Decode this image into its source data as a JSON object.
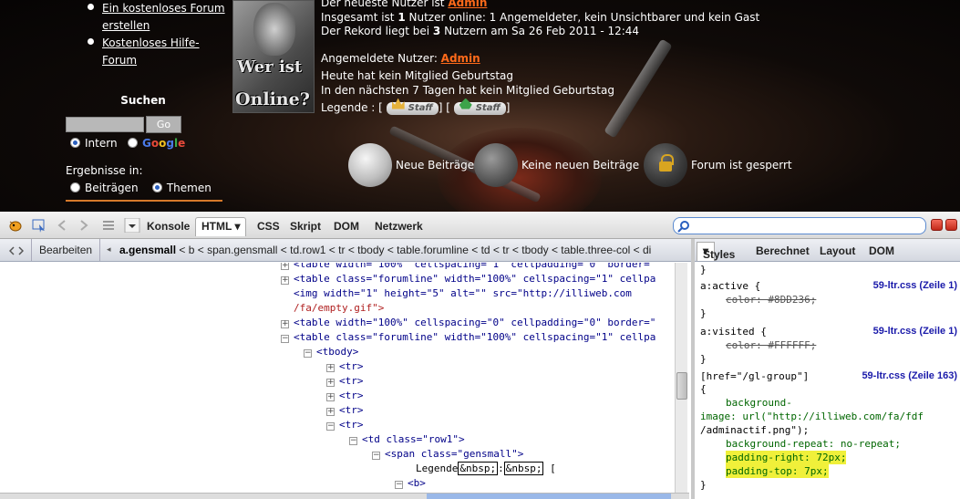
{
  "forum": {
    "sidebar_links": [
      "Ein kostenloses Forum erstellen",
      "Kostenloses Hilfe-Forum"
    ],
    "search": {
      "title": "Suchen",
      "go_label": "Go",
      "engine_intern": "Intern",
      "engine_google": "Google",
      "results_label": "Ergebnisse in:",
      "opt_posts": "Beiträgen",
      "opt_topics": "Themen"
    },
    "online_image": {
      "line1": "Wer ist",
      "line2": "Online?"
    },
    "online": {
      "newest_prefix": "Der neueste Nutzer ist ",
      "newest_user": "Admin",
      "total_prefix": "Insgesamt ist ",
      "total_count": "1",
      "total_suffix": " Nutzer online: 1 Angemeldeter, kein Unsichtbarer und kein Gast",
      "record_prefix": "Der Rekord liegt bei ",
      "record_count": "3",
      "record_suffix": " Nutzern am Sa 26 Feb 2011 - 12:44",
      "logged_in_label": "Angemeldete Nutzer: ",
      "logged_in_user": "Admin",
      "birthday_today": "Heute hat kein Mitglied Geburtstag",
      "birthday_week": "In den nächsten 7 Tagen hat kein Mitglied Geburtstag",
      "legend_label": "Legende : [",
      "legend_mid": "] [",
      "legend_end": "]",
      "badge1": "Staff",
      "badge2": "Staff"
    },
    "icon_legend": [
      "Neue Beiträge",
      "Keine neuen Beiträge",
      "Forum ist gesperrt"
    ]
  },
  "firebug": {
    "tabs": [
      "Konsole",
      "HTML",
      "CSS",
      "Skript",
      "DOM",
      "Netzwerk"
    ],
    "active_tab": "HTML",
    "edit_label": "Bearbeiten",
    "breadcrumb_first": "a.gensmall",
    "breadcrumb_rest": "< b < span.gensmall < td.row1 < tr < tbody < table.forumline < td < tr < tbody < table.three-col < di",
    "side_tabs": [
      "Styles",
      "Berechnet",
      "Layout",
      "DOM"
    ],
    "active_side_tab": "Styles",
    "html_lines": [
      {
        "t": "<table width=\"100%\" cellspacing=\"1\" cellpadding=\"0\" border=\""
      },
      {
        "t": "<table class=\"forumline\" width=\"100%\" cellspacing=\"1\" cellpa"
      },
      {
        "t": "<img width=\"1\" height=\"5\" alt=\"\" src=\"http://illiweb.com"
      },
      {
        "t": "/fa/empty.gif\">"
      },
      {
        "t": "<table width=\"100%\" cellspacing=\"0\" cellpadding=\"0\" border=\""
      },
      {
        "t": "<table class=\"forumline\" width=\"100%\" cellspacing=\"1\" cellpa"
      },
      {
        "t": "<tbody>"
      },
      {
        "t": "<tr>"
      },
      {
        "t": "<tr>"
      },
      {
        "t": "<tr>"
      },
      {
        "t": "<tr>"
      },
      {
        "t": "<tr>"
      },
      {
        "t": "<td class=\"row1\">"
      },
      {
        "t": "<span class=\"gensmall\">"
      },
      {
        "t": "Legende"
      },
      {
        "t": "<b>"
      }
    ],
    "legend_entities": [
      "&nbsp;",
      ":",
      "&nbsp;",
      "["
    ],
    "css_rules": {
      "brace": "}",
      "rule1_selector": "a:active {",
      "rule1_prop": "color: #8DD236;",
      "rule1_src": "59-ltr.css (Zeile 1)",
      "rule2_selector": "a:visited {",
      "rule2_prop": "color: #FFFFFF;",
      "rule2_src": "59-ltr.css (Zeile 1)",
      "rule3_selector": "[href=\"/gl-group\"]",
      "rule3_src": "59-ltr.css (Zeile 163)",
      "rule3_open": "{",
      "bg_image_1": "background-",
      "bg_image_2": "image: url(\"http://illiweb.com/fa/fdf",
      "bg_image_3": "/adminactif.png\");",
      "bg_repeat": "background-repeat: no-repeat;",
      "padding_right": "padding-right: 72px;",
      "padding_top": "padding-top: 7px;"
    }
  }
}
